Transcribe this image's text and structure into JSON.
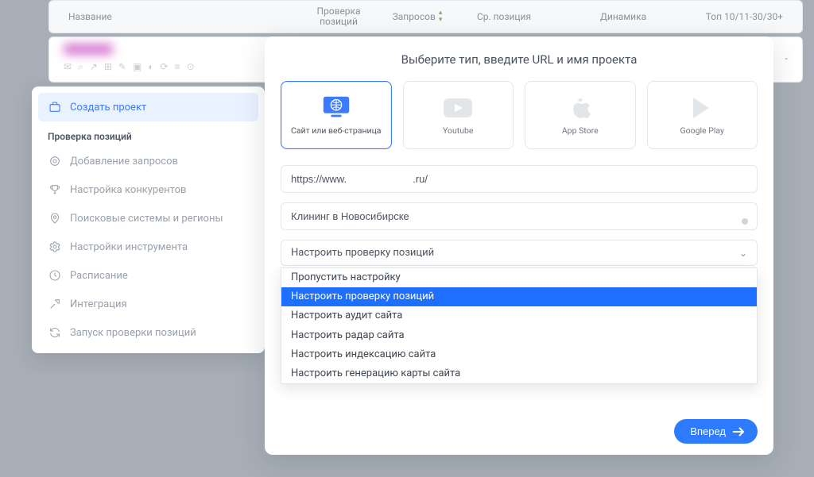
{
  "table_header": {
    "name": "Название",
    "position_check": "Проверка позиций",
    "requests": "Запросов",
    "avg_position": "Ср. позиция",
    "dynamics": "Динамика",
    "top": "Топ 10/11-30/30+"
  },
  "sidebar": {
    "create_project": "Создать проект",
    "section_label": "Проверка позиций",
    "items": [
      "Добавление запросов",
      "Настройка конкурентов",
      "Поисковые системы и регионы",
      "Настройки инструмента",
      "Расписание",
      "Интеграция",
      "Запуск проверки позиций"
    ]
  },
  "modal": {
    "title": "Выберите тип, введите URL и имя проекта",
    "types": {
      "website": "Сайт или веб-страница",
      "youtube": "Youtube",
      "appstore": "App Store",
      "googleplay": "Google Play"
    },
    "url_value": "https://www.                       .ru/",
    "name_value": "Клининг в Новосибирске",
    "select_label": "Настроить проверку позиций",
    "dropdown": [
      "Пропустить настройку",
      "Настроить проверку позиций",
      "Настроить аудит сайта",
      "Настроить радар сайта",
      "Настроить индексацию сайта",
      "Настроить генерацию карты сайта"
    ],
    "selected_index": 1,
    "forward_label": "Вперед"
  }
}
